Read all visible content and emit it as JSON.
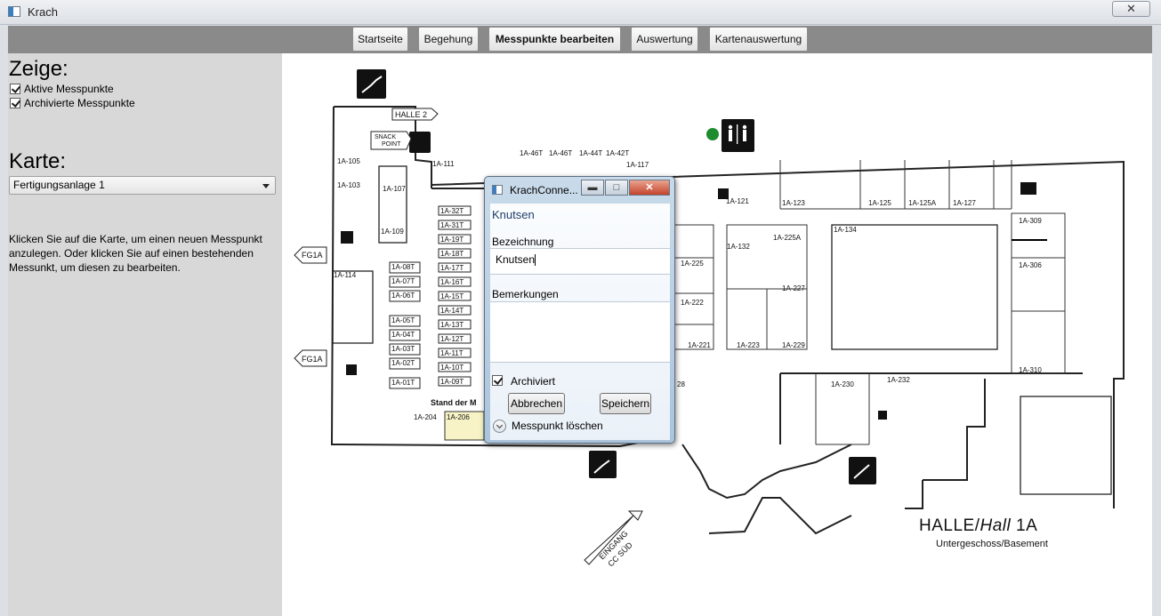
{
  "window": {
    "title": "Krach",
    "close_label": "✕"
  },
  "nav": {
    "tabs": [
      {
        "label": "Startseite"
      },
      {
        "label": "Begehung"
      },
      {
        "label": "Messpunkte bearbeiten",
        "active": true
      },
      {
        "label": "Auswertung"
      },
      {
        "label": "Kartenauswertung"
      }
    ]
  },
  "sidebar": {
    "show_heading": "Zeige:",
    "checkboxes": [
      {
        "label": "Aktive Messpunkte",
        "checked": true
      },
      {
        "label": "Archivierte Messpunkte",
        "checked": true
      }
    ],
    "map_heading": "Karte:",
    "map_select_value": "Fertigungsanlage 1",
    "help_text": "Klicken Sie auf die Karte, um einen neuen Messpunkt anzulegen. Oder klicken Sie auf einen bestehenden Messunkt, um diesen zu bearbeiten."
  },
  "map": {
    "hall_title": "HALLE/",
    "hall_title_italic": "Hall",
    "hall_number": " 1A",
    "hall_subtitle": "Untergeschoss/Basement",
    "entrance": "EINGANG",
    "entrance_sub": "CC SÜD",
    "halle2": "HALLE 2",
    "snack": "SNACK",
    "point": "POINT",
    "fg1a": "FG1A",
    "stand": "Stand der M",
    "marker_color": "#1e8c2e",
    "rooms_top": [
      "1A-46T",
      "1A-46T",
      "1A-44T",
      "1A-42T"
    ],
    "room_labels": [
      "1A-105",
      "1A-103",
      "1A-107",
      "1A-109",
      "1A-111",
      "1A-117",
      "1A-114",
      "1A-121",
      "1A-123",
      "1A-125",
      "1A-125A",
      "1A-127",
      "1A-132",
      "1A-225A",
      "1A-134",
      "1A-309",
      "1A-306",
      "1A-225",
      "1A-222",
      "1A-221",
      "1A-227",
      "1A-223",
      "1A-229",
      "1A-310",
      "1A-230",
      "1A-232",
      "1A-204",
      "1A-206",
      "28"
    ],
    "stand_left": [
      "1A-08T",
      "1A-07T",
      "1A-06T",
      "1A-05T",
      "1A-04T",
      "1A-03T",
      "1A-02T",
      "1A-01T"
    ],
    "stand_right": [
      "1A-32T",
      "1A-31T",
      "1A-19T",
      "1A-18T",
      "1A-17T",
      "1A-16T",
      "1A-15T",
      "1A-14T",
      "1A-13T",
      "1A-12T",
      "1A-11T",
      "1A-10T",
      "1A-09T"
    ]
  },
  "dialog": {
    "title": "KrachConne...",
    "minimize_label": "▬",
    "maximize_label": "□",
    "close_label": "✕",
    "point_name": "Knutsen",
    "bezeichnung_label": "Bezeichnung",
    "bezeichnung_value": "Knutsen",
    "bemerkungen_label": "Bemerkungen",
    "bemerkungen_value": "",
    "archiviert_label": "Archiviert",
    "archiviert_checked": true,
    "cancel_label": "Abbrechen",
    "save_label": "Speichern",
    "delete_label": "Messpunkt löschen"
  }
}
